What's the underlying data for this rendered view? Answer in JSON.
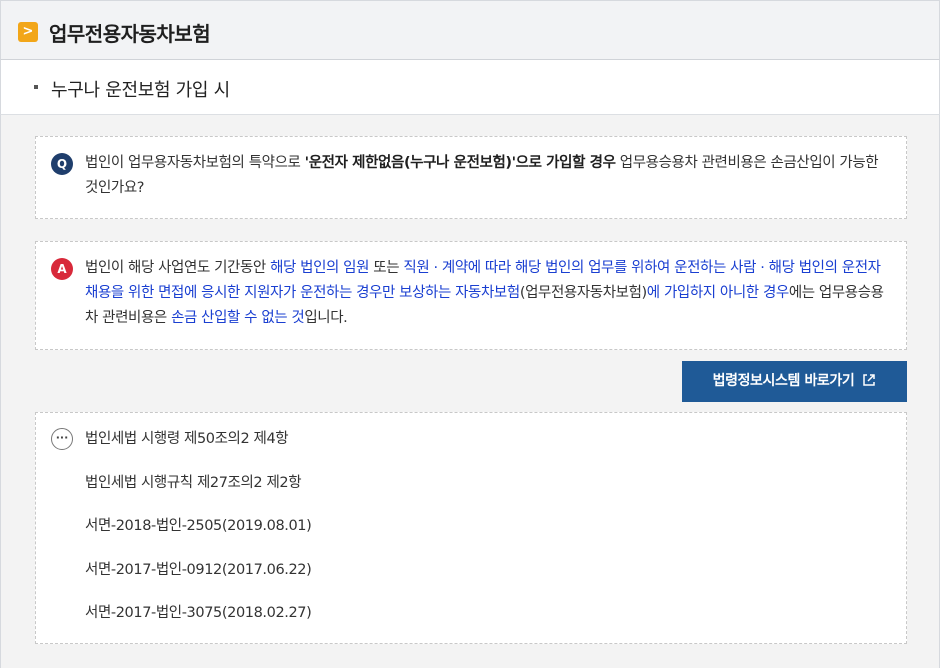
{
  "header": {
    "title": "업무전용자동차보험",
    "chevron_icon": "chevron-right-icon",
    "accent": "#f2a619"
  },
  "subheader": {
    "title": "누구나 운전보험 가입 시"
  },
  "question": {
    "badge": "Q",
    "segments": [
      {
        "text": "법인이 업무용자동차보험의 특약으로 ",
        "style": "normal"
      },
      {
        "text": "'운전자 제한없음(누구나 운전보험)'으로 가입할 경우",
        "style": "bold"
      },
      {
        "text": " 업무용승용차 관련비용은 손금산입이 가능한 것인가요?",
        "style": "normal"
      }
    ]
  },
  "answer": {
    "badge": "A",
    "segments": [
      {
        "text": "법인이 해당 사업연도 기간동안 ",
        "style": "normal"
      },
      {
        "text": "해당 법인의 임원",
        "style": "hl"
      },
      {
        "text": " 또는 ",
        "style": "normal"
      },
      {
        "text": "직원 · 계약에 따라 해당 법인의 업무를 위하여 운전하는 사람 · 해당 법인의 운전자 채용을 위한 면접에 응시한 지원자가 운전하는 경우만 보상하는 자동차보험",
        "style": "hl"
      },
      {
        "text": "(업무전용자동차보험)",
        "style": "normal"
      },
      {
        "text": "에 가입하지 아니한 경우",
        "style": "hl"
      },
      {
        "text": "에는 업무용승용차 관련비용은 ",
        "style": "normal"
      },
      {
        "text": "손금 산입할 수 없는 것",
        "style": "hl"
      },
      {
        "text": "입니다.",
        "style": "normal"
      }
    ]
  },
  "link_button": {
    "label": "법령정보시스템 바로가기",
    "icon": "external-link-icon"
  },
  "references": {
    "icon": "more-icon",
    "badge": "···",
    "items": [
      "법인세법 시행령 제50조의2 제4항",
      "법인세법 시행규칙 제27조의2 제2항",
      "서면-2018-법인-2505(2019.08.01)",
      "서면-2017-법인-0912(2017.06.22)",
      "서면-2017-법인-3075(2018.02.27)"
    ]
  },
  "colors": {
    "question_badge": "#1f3e6c",
    "answer_badge": "#d8293a",
    "highlight": "#1a3fd1",
    "button": "#1f5a97"
  }
}
